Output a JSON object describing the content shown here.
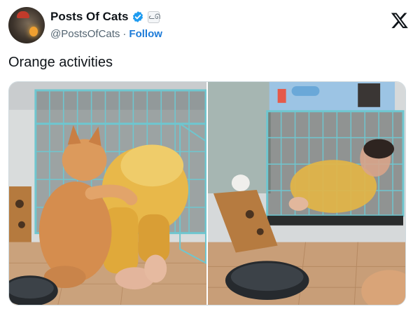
{
  "author": {
    "display_name": "Posts Of Cats",
    "handle": "@PostsOfCats",
    "separator": "·",
    "follow_label": "Follow",
    "verified_icon": "verified-badge-icon",
    "affiliate_icon": "cat-affiliate-badge-icon"
  },
  "tweet": {
    "text": "Orange activities"
  },
  "media": {
    "photos": [
      {
        "name": "photo-kitten-pushing-person-into-crate"
      },
      {
        "name": "photo-person-inside-crate"
      }
    ]
  },
  "colors": {
    "accent": "#1d9bf0",
    "text": "#0f1419",
    "secondary": "#536471"
  },
  "icons": {
    "close": "x-logo-icon"
  }
}
